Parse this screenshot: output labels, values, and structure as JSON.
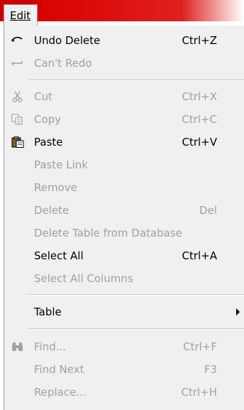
{
  "menubar": {
    "edit_label": "Edit"
  },
  "menu": {
    "undo": {
      "label": "Undo Delete",
      "shortcut": "Ctrl+Z",
      "icon": "undo-icon"
    },
    "redo": {
      "label": "Can't Redo",
      "icon": "redo-icon"
    },
    "cut": {
      "label": "Cut",
      "shortcut": "Ctrl+X",
      "icon": "scissors-icon"
    },
    "copy": {
      "label": "Copy",
      "shortcut": "Ctrl+C",
      "icon": "copy-icon"
    },
    "paste": {
      "label": "Paste",
      "shortcut": "Ctrl+V",
      "icon": "clipboard-icon"
    },
    "paste_link": {
      "label": "Paste Link"
    },
    "remove": {
      "label": "Remove"
    },
    "delete": {
      "label": "Delete",
      "shortcut": "Del"
    },
    "delete_table": {
      "label": "Delete Table from Database"
    },
    "select_all": {
      "label": "Select All",
      "shortcut": "Ctrl+A"
    },
    "select_all_columns": {
      "label": "Select All Columns"
    },
    "table": {
      "label": "Table"
    },
    "find": {
      "label": "Find...",
      "shortcut": "Ctrl+F",
      "icon": "binoculars-icon"
    },
    "find_next": {
      "label": "Find Next",
      "shortcut": "F3"
    },
    "replace": {
      "label": "Replace...",
      "shortcut": "Ctrl+H"
    }
  }
}
